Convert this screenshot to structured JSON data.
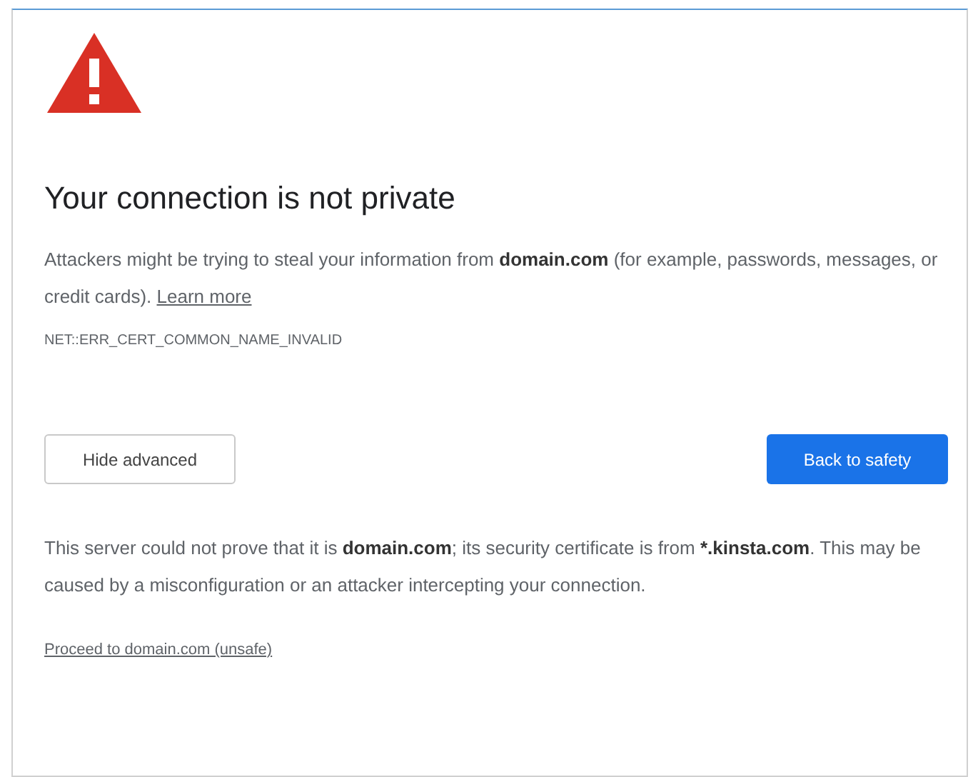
{
  "heading": "Your connection is not private",
  "description": "Attackers might be trying to steal your information from **domain.com** (for example, passwords, messages, or credit cards).",
  "learn_more_link": "Learn more",
  "error_code": "NET::ERR_CERT_COMMON_NAME_INVALID",
  "buttons": [
    {
      "label": "Hide advanced",
      "kind": "secondary"
    },
    {
      "label": "Back to safety",
      "kind": "primary"
    }
  ],
  "details": "This server could not prove that it is **domain.com**; its security certificate is from ***.kinsta.com**. This may be caused by a misconfiguration or an attacker intercepting your connection.",
  "proceed_link": "Proceed to domain.com (unsafe)"
}
